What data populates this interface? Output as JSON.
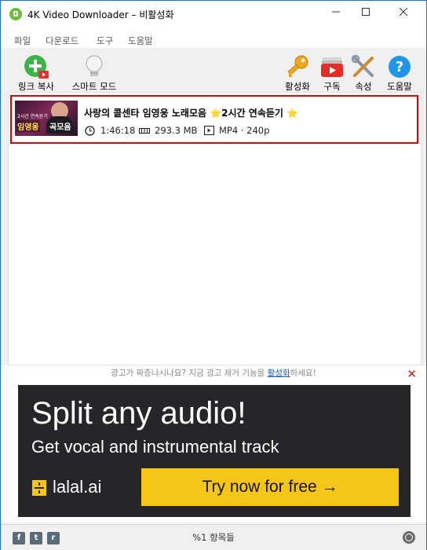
{
  "window": {
    "title": "4K Video Downloader – 비활성화",
    "minimize_icon": "minimize-icon",
    "maximize_icon": "maximize-icon",
    "close_icon": "close-icon"
  },
  "menu": [
    "파일",
    "다운로드",
    "도구",
    "도움말"
  ],
  "toolbar": {
    "paste_link": "링크 복사",
    "smart_mode": "스마트 모드",
    "activate": "활성화",
    "subscribe": "구독",
    "preferences": "속성",
    "help": "도움말"
  },
  "downloads": [
    {
      "title": "사랑의 콜센타 임영웅 노래모음 ⭐2시간 연속듣기 ⭐",
      "duration": "1:46:18",
      "size": "293.3 MB",
      "format": "MP4 · 240p",
      "thumb_caption": "2시간 연속듣기",
      "thumb_name": "임영웅",
      "thumb_suffix": "곡모음"
    }
  ],
  "ad_notice": {
    "prefix": "광고가 짜증나시나요? 지금 광고 제거 기능을 ",
    "link": "활성화",
    "suffix": "하세요!"
  },
  "banner": {
    "headline": "Split any audio!",
    "subline": "Get vocal and instrumental track",
    "brand": "lalal.ai",
    "cta": "Try now for free →"
  },
  "status": {
    "items": "%1 항목들"
  },
  "colors": {
    "accent": "#1f6fd1",
    "highlight_border": "#e00000",
    "banner_bg": "#262629",
    "cta_bg": "#f5c518"
  }
}
